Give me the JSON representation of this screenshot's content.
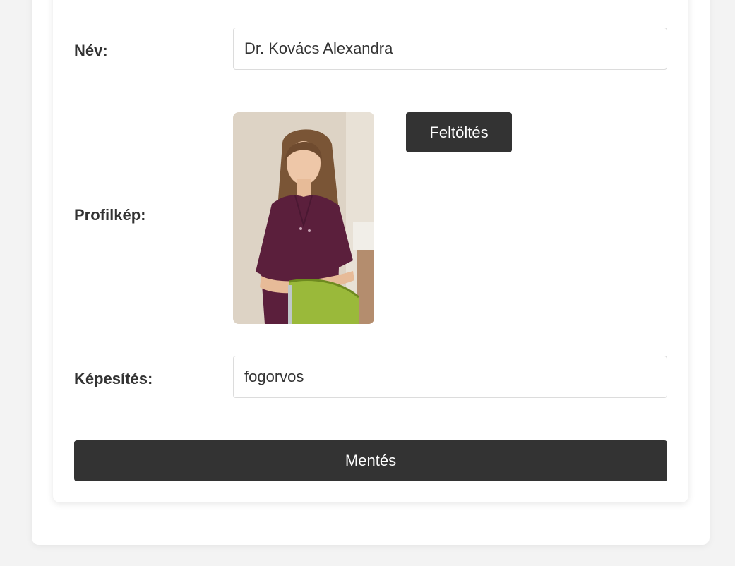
{
  "form": {
    "name": {
      "label": "Név:",
      "value": "Dr. Kovács Alexandra"
    },
    "profile_picture": {
      "label": "Profilkép:",
      "upload_button": "Feltöltés"
    },
    "qualification": {
      "label": "Képesítés:",
      "value": "fogorvos"
    },
    "save_button": "Mentés"
  },
  "colors": {
    "page_background": "#f3f3f3",
    "card_background": "#ffffff",
    "button_background": "#333333",
    "button_text": "#ffffff",
    "text": "#333333"
  }
}
